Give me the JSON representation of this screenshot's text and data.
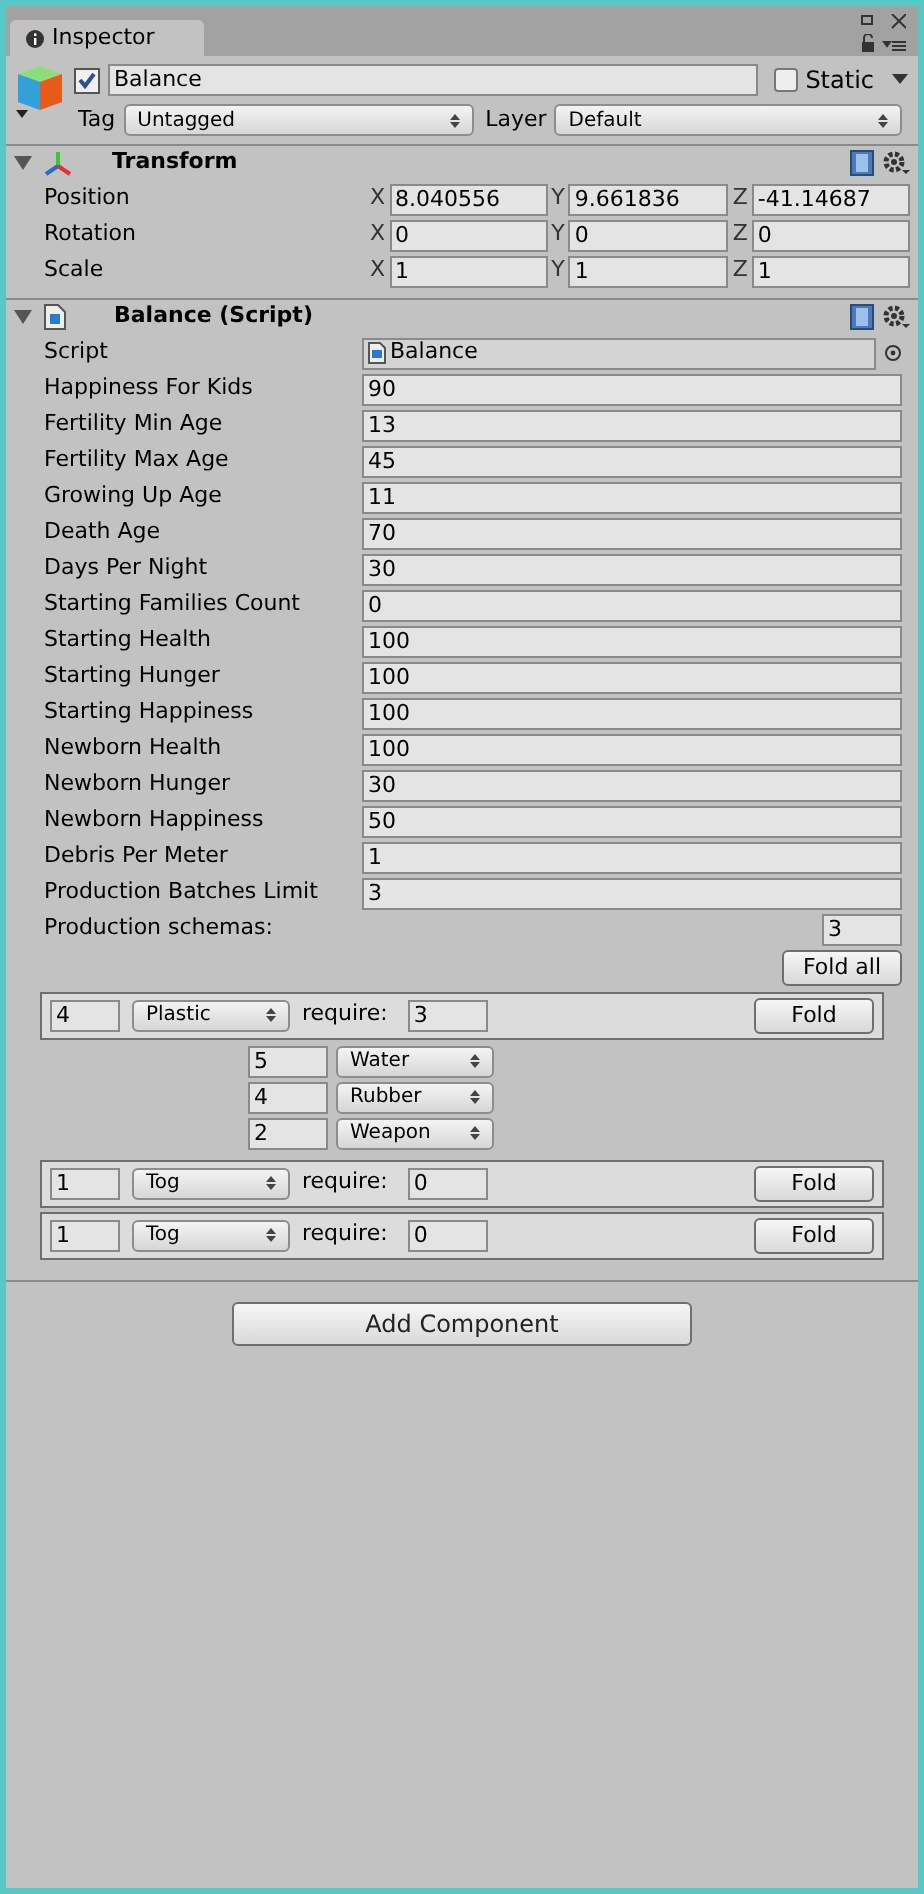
{
  "tab": {
    "label": "Inspector",
    "selected": true
  },
  "object": {
    "active": true,
    "name": "Balance",
    "static_label": "Static",
    "static": false,
    "tag_label": "Tag",
    "tag": "Untagged",
    "layer_label": "Layer",
    "layer": "Default"
  },
  "transform": {
    "title": "Transform",
    "expanded": true,
    "rows": [
      {
        "label": "Position",
        "values": [
          {
            "axis": "X",
            "value": "8.040556"
          },
          {
            "axis": "Y",
            "value": "9.661836"
          },
          {
            "axis": "Z",
            "value": "-41.14687"
          }
        ]
      },
      {
        "label": "Rotation",
        "values": [
          {
            "axis": "X",
            "value": "0"
          },
          {
            "axis": "Y",
            "value": "0"
          },
          {
            "axis": "Z",
            "value": "0"
          }
        ]
      },
      {
        "label": "Scale",
        "values": [
          {
            "axis": "X",
            "value": "1"
          },
          {
            "axis": "Y",
            "value": "1"
          },
          {
            "axis": "Z",
            "value": "1"
          }
        ]
      }
    ]
  },
  "script_component": {
    "title": "Balance (Script)",
    "expanded": true,
    "script_label": "Script",
    "script_value": "Balance",
    "fields": [
      {
        "label": "Happiness For Kids",
        "value": "90"
      },
      {
        "label": "Fertility Min Age",
        "value": "13"
      },
      {
        "label": "Fertility Max Age",
        "value": "45"
      },
      {
        "label": "Growing Up Age",
        "value": "11"
      },
      {
        "label": "Death Age",
        "value": "70"
      },
      {
        "label": "Days Per Night",
        "value": "30"
      },
      {
        "label": "Starting Families Count",
        "value": "0"
      },
      {
        "label": "Starting Health",
        "value": "100"
      },
      {
        "label": "Starting Hunger",
        "value": "100"
      },
      {
        "label": "Starting Happiness",
        "value": "100"
      },
      {
        "label": "Newborn Health",
        "value": "100"
      },
      {
        "label": "Newborn Hunger",
        "value": "30"
      },
      {
        "label": "Newborn Happiness",
        "value": "50"
      },
      {
        "label": "Debris Per Meter",
        "value": "1"
      },
      {
        "label": "Production Batches Limit",
        "value": "3"
      }
    ],
    "schemas_label": "Production schemas:",
    "schemas_count": "3",
    "fold_all": "Fold all",
    "schemas": [
      {
        "amount": "4",
        "product": "Plastic",
        "require_label": "require:",
        "require": "3",
        "fold": "Fold",
        "expanded": true,
        "ingredients": [
          {
            "amount": "5",
            "item": "Water"
          },
          {
            "amount": "4",
            "item": "Rubber"
          },
          {
            "amount": "2",
            "item": "Weapon"
          }
        ]
      },
      {
        "amount": "1",
        "product": "Tog",
        "require_label": "require:",
        "require": "0",
        "fold": "Fold",
        "expanded": false
      },
      {
        "amount": "1",
        "product": "Tog",
        "require_label": "require:",
        "require": "0",
        "fold": "Fold",
        "expanded": false
      }
    ]
  },
  "add_component": "Add Component"
}
